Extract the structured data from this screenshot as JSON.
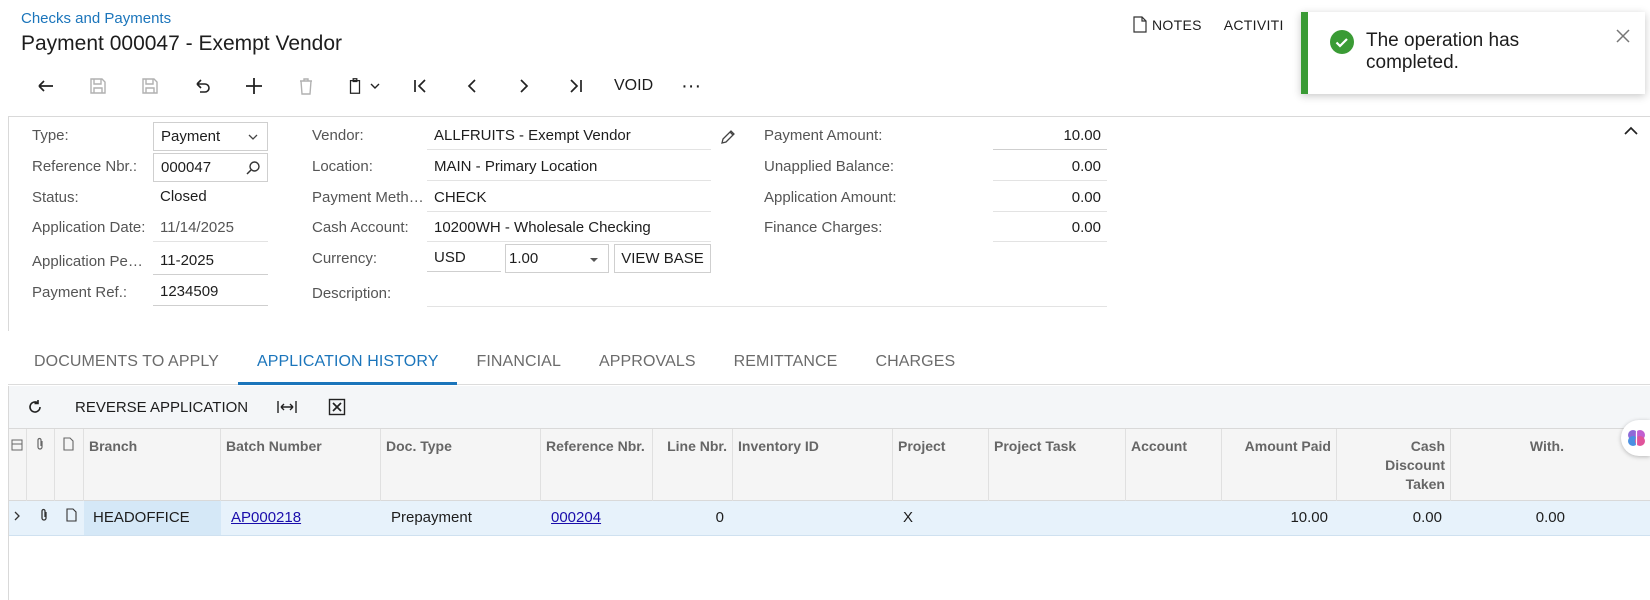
{
  "breadcrumb": "Checks and Payments",
  "title": "Payment 000047 - Exempt Vendor",
  "top_actions": {
    "notes": "NOTES",
    "activities": "ACTIVITI"
  },
  "toolbar": {
    "void_label": "VOID",
    "more_label": "···"
  },
  "form": {
    "type": {
      "label": "Type:",
      "value": "Payment"
    },
    "reference_nbr": {
      "label": "Reference Nbr.:",
      "value": "000047"
    },
    "status": {
      "label": "Status:",
      "value": "Closed"
    },
    "application_date": {
      "label": "Application Date:",
      "value": "11/14/2025"
    },
    "application_period": {
      "label": "Application Pe…",
      "value": "11-2025"
    },
    "payment_ref": {
      "label": "Payment Ref.:",
      "value": "1234509"
    },
    "vendor": {
      "label": "Vendor:",
      "value": "ALLFRUITS - Exempt Vendor"
    },
    "location": {
      "label": "Location:",
      "value": "MAIN - Primary Location"
    },
    "payment_method": {
      "label": "Payment Meth…",
      "value": "CHECK"
    },
    "cash_account": {
      "label": "Cash Account:",
      "value": "10200WH - Wholesale Checking"
    },
    "currency": {
      "label": "Currency:",
      "value": "USD",
      "rate": "1.00",
      "view_base": "VIEW BASE"
    },
    "description": {
      "label": "Description:",
      "value": ""
    },
    "payment_amount": {
      "label": "Payment Amount:",
      "value": "10.00"
    },
    "unapplied_balance": {
      "label": "Unapplied Balance:",
      "value": "0.00"
    },
    "application_amount": {
      "label": "Application Amount:",
      "value": "0.00"
    },
    "finance_charges": {
      "label": "Finance Charges:",
      "value": "0.00"
    }
  },
  "tabs": [
    "DOCUMENTS TO APPLY",
    "APPLICATION HISTORY",
    "FINANCIAL",
    "APPROVALS",
    "REMITTANCE",
    "CHARGES"
  ],
  "active_tab": "APPLICATION HISTORY",
  "grid_toolbar": {
    "reverse_label": "REVERSE APPLICATION"
  },
  "grid": {
    "headers": {
      "branch": "Branch",
      "batch_number": "Batch Number",
      "doc_type": "Doc. Type",
      "reference_nbr": "Reference Nbr.",
      "line_nbr": "Line Nbr.",
      "inventory_id": "Inventory ID",
      "project": "Project",
      "project_task": "Project Task",
      "account": "Account",
      "amount_paid": "Amount Paid",
      "cash_discount_taken": "Cash Discount Taken",
      "with": "With."
    },
    "rows": [
      {
        "branch": "HEADOFFICE",
        "batch_number": "AP000218",
        "doc_type": "Prepayment",
        "reference_nbr": "000204",
        "line_nbr": "0",
        "inventory_id": "",
        "project": "X",
        "project_task": "",
        "account": "",
        "amount_paid": "10.00",
        "cash_discount_taken": "0.00",
        "with": "0.00"
      }
    ]
  },
  "toast": {
    "message": "The operation has completed.",
    "accent": "#3a9b35"
  },
  "colors": {
    "link": "#1b75bb",
    "row_selected": "#e7f2fb"
  }
}
